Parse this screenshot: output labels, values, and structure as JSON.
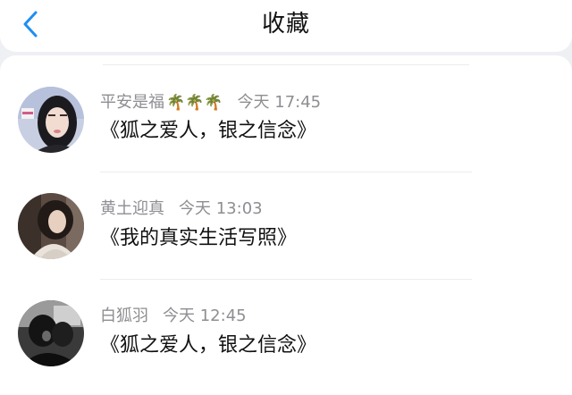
{
  "header": {
    "title": "收藏",
    "back_icon": "chevron-left-icon",
    "accent_color": "#1f8ef1"
  },
  "items": [
    {
      "name": "平安是福",
      "emoji": "🌴🌴🌴",
      "time": "今天 17:45",
      "message": "《狐之爱人，银之信念》"
    },
    {
      "name": "黄土迎真",
      "emoji": "",
      "time": "今天 13:03",
      "message": "《我的真实生活写照》"
    },
    {
      "name": "白狐羽",
      "emoji": "",
      "time": "今天 12:45",
      "message": "《狐之爱人，银之信念》"
    }
  ]
}
